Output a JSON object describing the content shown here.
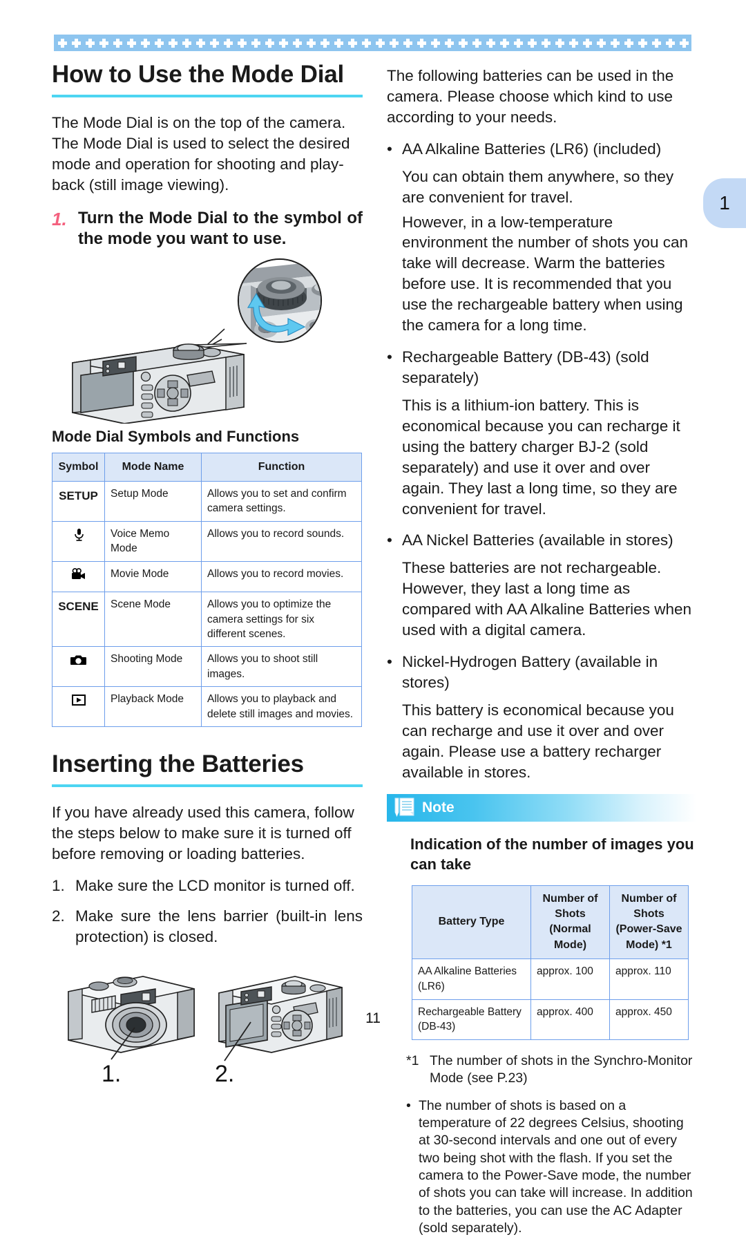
{
  "page": {
    "tab_label": "1",
    "folio": "11"
  },
  "left": {
    "title": "How to Use the Mode Dial",
    "intro": "The Mode Dial is on the top of the camera. The Mode Dial is used to select the desired mode and operation for shooting and play-back (still image viewing).",
    "step": {
      "number": "1.",
      "text": "Turn the Mode Dial to the symbol of the mode you want to use."
    },
    "dial_figure_alt": "camera-with-mode-dial-callout",
    "table_heading": "Mode Dial Symbols and Functions",
    "table": {
      "headers": [
        "Symbol",
        "Mode Name",
        "Function"
      ],
      "rows": [
        {
          "symbol": "SETUP",
          "symbol_kind": "text",
          "name": "Setup Mode",
          "function": "Allows you to set and confirm camera settings."
        },
        {
          "symbol": "\u0001",
          "symbol_kind": "microphone",
          "name": "Voice Memo Mode",
          "function": "Allows you to record sounds."
        },
        {
          "symbol": "\u0002",
          "symbol_kind": "movie-camera",
          "name": "Movie Mode",
          "function": "Allows you to record movies."
        },
        {
          "symbol": "SCENE",
          "symbol_kind": "text",
          "name": "Scene Mode",
          "function": "Allows you to optimize the camera settings for six different scenes."
        },
        {
          "symbol": "\u0003",
          "symbol_kind": "still-camera",
          "name": "Shooting Mode",
          "function": "Allows you to shoot still images."
        },
        {
          "symbol": "\u0004",
          "symbol_kind": "playback",
          "name": "Playback Mode",
          "function": "Allows you to playback and delete still images and movies."
        }
      ]
    },
    "title2": "Inserting the Batteries",
    "intro2": "If you have already used this camera, follow the steps below to make sure it is turned off before removing or loading batteries.",
    "steps2": [
      {
        "num": "1.",
        "text": "Make sure the LCD monitor is turned off."
      },
      {
        "num": "2.",
        "text": "Make sure the lens barrier (built-in lens protection) is closed."
      }
    ],
    "figure_labels": [
      "1.",
      "2."
    ]
  },
  "right": {
    "intro": "The following batteries can be used in the camera. Please choose which kind to use according to your needs.",
    "bullets": [
      {
        "label": "AA Alkaline Batteries (LR6) (included)",
        "body": "You can obtain them anywhere, so they are convenient for travel.\nHowever, in a low-temperature environment the number of shots you can take will decrease. Warm the batteries before use. It is recommended that you use the rechargeable battery when using the camera for a long time."
      },
      {
        "label": "Rechargeable Battery (DB-43) (sold separately)",
        "body": "This is a lithium-ion battery. This is economical because you can recharge it using the battery charger BJ-2 (sold separately) and use it over and over again. They last a long time, so they are convenient for travel."
      },
      {
        "label": "AA Nickel Batteries (available in stores)",
        "body": "These batteries are not rechargeable. However, they last a long time as compared with AA Alkaline Batteries when used with a digital camera."
      },
      {
        "label": "Nickel-Hydrogen Battery (available in stores)",
        "body": "This battery is economical because you can recharge and use it over and over again. Please use a battery recharger available in stores."
      }
    ],
    "note": {
      "bar_label": "Note",
      "icon": "note-paper-pencil-icon",
      "title": "Indication of the number of images you can take",
      "table": {
        "headers": [
          "Battery Type",
          "Number of Shots (Normal Mode)",
          "Number of Shots (Power-Save Mode) *1"
        ],
        "rows": [
          [
            "AA Alkaline Batteries (LR6)",
            "approx. 100",
            "approx. 110"
          ],
          [
            "Rechargeable Battery (DB-43)",
            "approx. 400",
            "approx. 450"
          ]
        ]
      },
      "footnote_mark": "*1",
      "footnote_text": "The number of shots in the Synchro-Monitor Mode (see P.23)",
      "bullet_mark": "•",
      "bullet_text": "The number of shots is based on a temperature of 22 degrees Celsius, shooting at 30-second intervals and one out of every two being shot with the flash. If you set the camera to the Power-Save mode, the number of shots you can take will increase. In addition to the batteries, you can use the AC Adapter (sold separately)."
    }
  },
  "colors": {
    "rule": "#4dd5f2",
    "band": "#8ec5ef",
    "table_header": "#dbe7f8",
    "table_border": "#6d9eeb",
    "step_number": "#f4607e",
    "tab": "#c3d9f5",
    "note_bar": "#27b6ea"
  }
}
